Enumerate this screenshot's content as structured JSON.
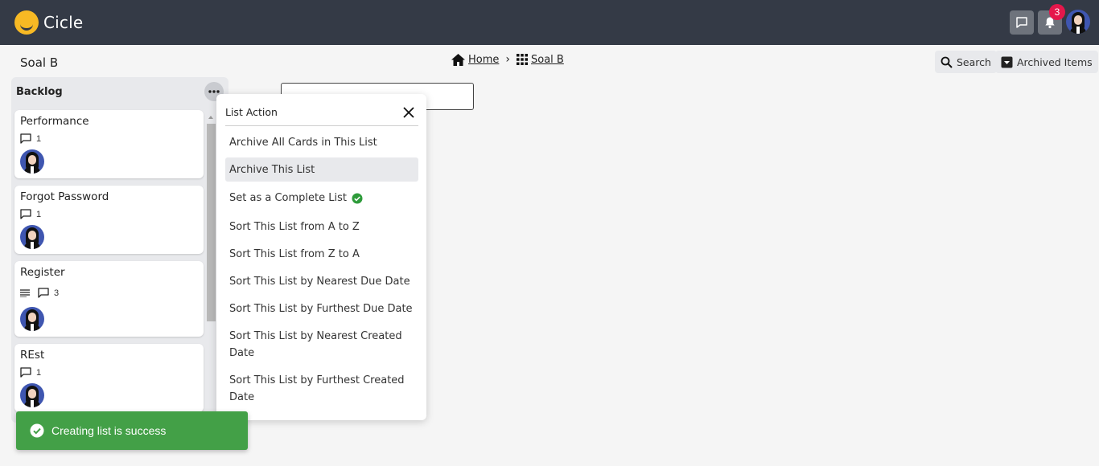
{
  "app": {
    "name": "Cicle"
  },
  "topbar": {
    "notification_count": "3"
  },
  "page": {
    "title": "Soal B",
    "breadcrumb": [
      {
        "label": "Home",
        "icon": "home-icon"
      },
      {
        "label": "Soal B",
        "icon": "grid-icon"
      }
    ],
    "breadcrumb_separator": "›",
    "search_label": "Search",
    "archived_label": "Archived Items"
  },
  "list": {
    "title": "Backlog",
    "cards": [
      {
        "title": "Performance",
        "comments": "1",
        "has_description": false
      },
      {
        "title": "Forgot Password",
        "comments": "1",
        "has_description": false
      },
      {
        "title": "Register",
        "comments": "3",
        "has_description": true
      },
      {
        "title": "REst",
        "comments": "1",
        "has_description": false
      }
    ]
  },
  "popover": {
    "title": "List Action",
    "items": [
      {
        "label": "Archive All Cards in This List"
      },
      {
        "label": "Archive This List",
        "active": true
      },
      {
        "label": "Set as a Complete List",
        "check": true
      },
      {
        "label": "Sort This List from A to Z"
      },
      {
        "label": "Sort This List from Z to A"
      },
      {
        "label": "Sort This List by Nearest Due Date"
      },
      {
        "label": "Sort This List by Furthest Due Date"
      },
      {
        "label": "Sort This List by Nearest Created Date"
      },
      {
        "label": "Sort This List by Furthest Created Date"
      }
    ]
  },
  "toast": {
    "message": "Creating list is success"
  },
  "colors": {
    "topbar": "#343a46",
    "logo": "#f7b924",
    "badge": "#e5174b",
    "toast": "#43a047",
    "check": "#2e9b3a"
  }
}
